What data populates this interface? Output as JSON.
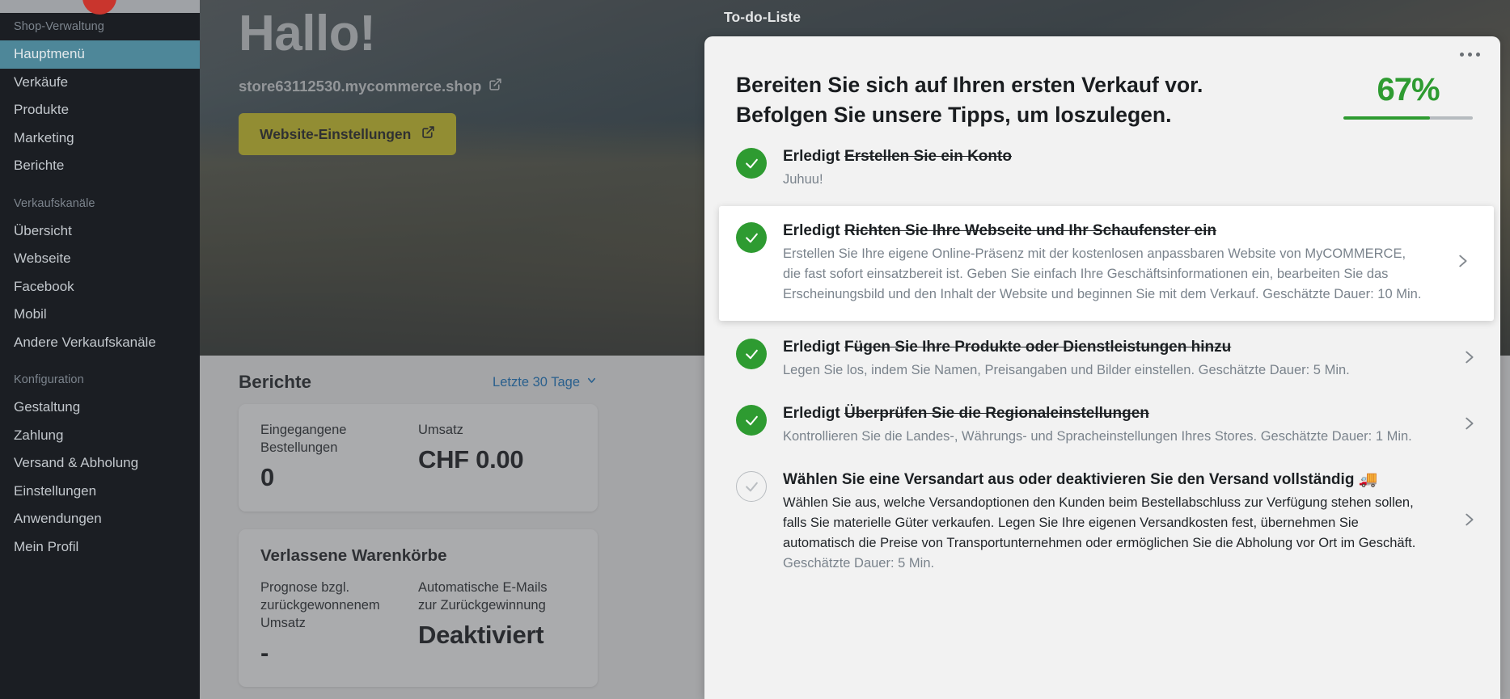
{
  "sidebar": {
    "brand_label": "Shop-Verwaltung",
    "groups": [
      {
        "label": null,
        "items": [
          {
            "label": "Hauptmenü",
            "active": true
          },
          {
            "label": "Verkäufe",
            "active": false
          },
          {
            "label": "Produkte",
            "active": false
          },
          {
            "label": "Marketing",
            "active": false
          },
          {
            "label": "Berichte",
            "active": false
          }
        ]
      },
      {
        "label": "Verkaufskanäle",
        "items": [
          {
            "label": "Übersicht",
            "active": false
          },
          {
            "label": "Webseite",
            "active": false
          },
          {
            "label": "Facebook",
            "active": false
          },
          {
            "label": "Mobil",
            "active": false
          },
          {
            "label": "Andere Verkaufskanäle",
            "active": false
          }
        ]
      },
      {
        "label": "Konfiguration",
        "items": [
          {
            "label": "Gestaltung",
            "active": false
          },
          {
            "label": "Zahlung",
            "active": false
          },
          {
            "label": "Versand & Abholung",
            "active": false
          },
          {
            "label": "Einstellungen",
            "active": false
          },
          {
            "label": "Anwendungen",
            "active": false
          },
          {
            "label": "Mein Profil",
            "active": false
          }
        ]
      }
    ]
  },
  "hero": {
    "greeting": "Hallo!",
    "store_url": "store63112530.mycommerce.shop",
    "settings_button": "Website-Einstellungen"
  },
  "reports": {
    "title": "Berichte",
    "range_label": "Letzte 30 Tage",
    "kpi_card": {
      "orders_label": "Eingegangene Bestellungen",
      "orders_value": "0",
      "revenue_label": "Umsatz",
      "revenue_value": "CHF 0.00"
    },
    "abandoned_card": {
      "title": "Verlassene Warenkörbe",
      "forecast_label": "Prognose bzgl. zurückgewonnenem Umsatz",
      "forecast_value": "-",
      "emails_label": "Automatische E-Mails zur Zurückgewinnung",
      "emails_value": "Deaktiviert"
    }
  },
  "todo": {
    "panel_label": "To-do-Liste",
    "heading_line1": "Bereiten Sie sich auf Ihren ersten Verkauf vor.",
    "heading_line2": "Befolgen Sie unsere Tipps, um loszulegen.",
    "progress_percent": "67%",
    "progress_value": 67,
    "progress_color": "#2e9b31",
    "tasks": [
      {
        "done": true,
        "done_prefix": "Erledigt ",
        "title": "Erstellen Sie ein Konto",
        "desc": "Juhuu!",
        "duration": "",
        "highlight": false,
        "chevron": false,
        "emoji": ""
      },
      {
        "done": true,
        "done_prefix": "Erledigt ",
        "title": "Richten Sie Ihre Webseite und Ihr Schaufenster ein",
        "desc": "Erstellen Sie Ihre eigene Online-Präsenz mit der kostenlosen anpassbaren Website von MyCOMMERCE, die fast sofort einsatzbereit ist. Geben Sie einfach Ihre Geschäftsinformationen ein, bearbeiten Sie das Erscheinungsbild und den Inhalt der Website und beginnen Sie mit dem Verkauf. ",
        "duration": "Geschätzte Dauer: 10 Min.",
        "highlight": true,
        "chevron": true,
        "emoji": ""
      },
      {
        "done": true,
        "done_prefix": "Erledigt ",
        "title": "Fügen Sie Ihre Produkte oder Dienstleistungen hinzu",
        "desc": "Legen Sie los, indem Sie Namen, Preisangaben und Bilder einstellen. ",
        "duration": "Geschätzte Dauer: 5 Min.",
        "highlight": false,
        "chevron": true,
        "emoji": ""
      },
      {
        "done": true,
        "done_prefix": "Erledigt ",
        "title": "Überprüfen Sie die Regionaleinstellungen",
        "desc": "Kontrollieren Sie die Landes-, Währungs- und Spracheinstellungen Ihres Stores. ",
        "duration": "Geschätzte Dauer: 1 Min.",
        "highlight": false,
        "chevron": true,
        "emoji": ""
      },
      {
        "done": false,
        "done_prefix": "",
        "title": "Wählen Sie eine Versandart aus oder deaktivieren Sie den Versand vollständig",
        "desc": "Wählen Sie aus, welche Versandoptionen den Kunden beim Bestellabschluss zur Verfügung stehen sollen, falls Sie materielle Güter verkaufen. Legen Sie Ihre eigenen Versandkosten fest, übernehmen Sie automatisch die Preise von Transportunternehmen oder ermöglichen Sie die Abholung vor Ort im Geschäft. ",
        "duration": "Geschätzte Dauer: 5 Min.",
        "highlight": false,
        "chevron": true,
        "emoji": "🚚"
      }
    ]
  },
  "icons": {
    "external_link": "external-link-icon",
    "chevron_down": "chevron-down-icon",
    "chevron_right": "chevron-right-icon",
    "check": "check-icon",
    "kebab": "more-options-icon"
  }
}
